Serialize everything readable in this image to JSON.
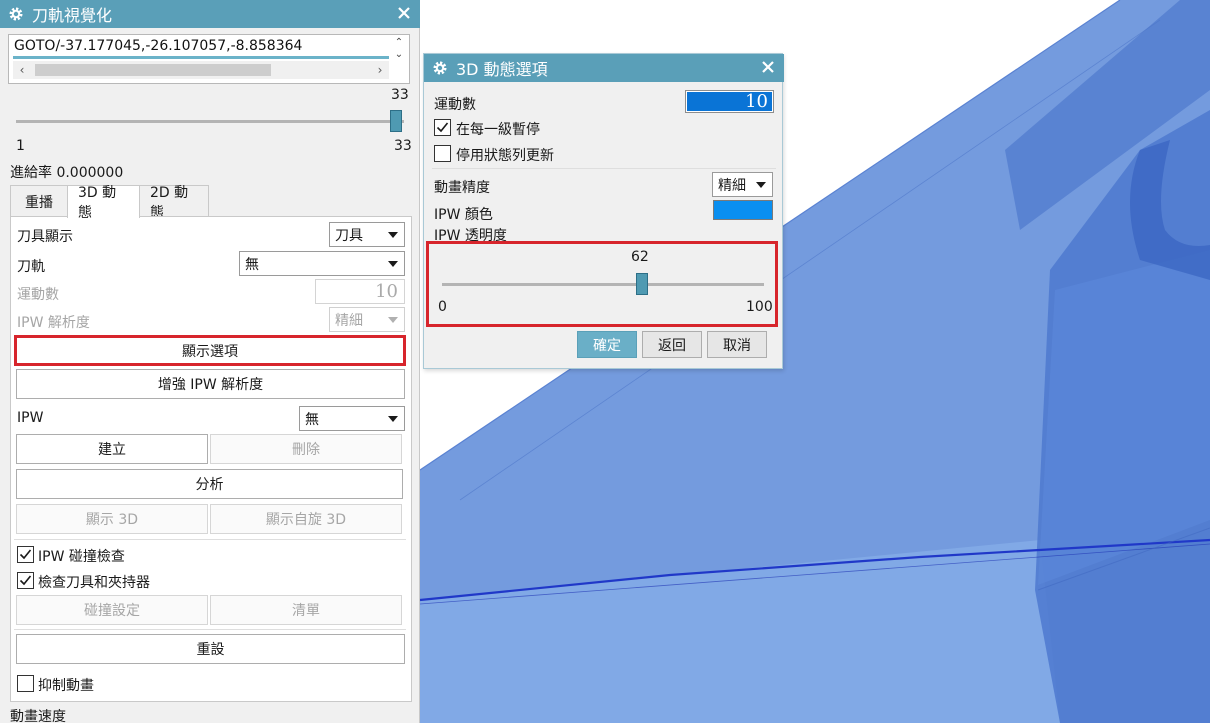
{
  "main_panel": {
    "title": "刀軌視覺化",
    "goto_text": "GOTO/-37.177045,-26.107057,-8.858364",
    "step_slider": {
      "value": 33,
      "min": 1,
      "max": 33,
      "value_label": "33",
      "min_label": "1",
      "max_label": "33"
    },
    "feed_rate_label": "進給率 0.000000",
    "tabs": [
      {
        "label": "重播",
        "active": false
      },
      {
        "label": "3D 動態",
        "active": true
      },
      {
        "label": "2D 動態",
        "active": false
      }
    ],
    "tool_display": {
      "label": "刀具顯示",
      "value": "刀具"
    },
    "toolpath": {
      "label": "刀軌",
      "value": "無"
    },
    "motion_count": {
      "label": "運動數",
      "value": "10"
    },
    "ipw_resolution": {
      "label": "IPW 解析度",
      "value": "精細"
    },
    "display_options_button": "顯示選項",
    "enhance_ipw_button": "增強 IPW 解析度",
    "ipw": {
      "label": "IPW",
      "value": "無"
    },
    "create_button": "建立",
    "delete_button": "刪除",
    "analyze_button": "分析",
    "show_3d_button": "顯示 3D",
    "show_spin_3d_button": "顯示自旋 3D",
    "ipw_collision_check": {
      "label": "IPW 碰撞檢查",
      "checked": true
    },
    "check_tool_holder": {
      "label": "檢查刀具和夾持器",
      "checked": true
    },
    "collision_settings_button": "碰撞設定",
    "list_button": "清單",
    "reset_button": "重設",
    "suppress_animation": {
      "label": "抑制動畫",
      "checked": false
    },
    "animation_speed_label": "動畫速度"
  },
  "options_dialog": {
    "title": "3D 動態選項",
    "motion_count": {
      "label": "運動數",
      "value": "10"
    },
    "pause_each_level": {
      "label": "在每一級暫停",
      "checked": true
    },
    "disable_status_update": {
      "label": "停用狀態列更新",
      "checked": false
    },
    "animation_precision": {
      "label": "動畫精度",
      "value": "精細"
    },
    "ipw_color": {
      "label": "IPW 顏色",
      "color": "#0a8ff0"
    },
    "ipw_transparency": {
      "label": "IPW 透明度",
      "value": 62,
      "min": 0,
      "max": 100,
      "value_label": "62",
      "min_label": "0",
      "max_label": "100"
    },
    "ok_button": "確定",
    "back_button": "返回",
    "cancel_button": "取消"
  },
  "colors": {
    "title_bar": "#5a9fb8",
    "highlight_frame": "#d7252c",
    "selection": "#0a74d6",
    "slider_thumb": "#4f9ab2",
    "model_blue": "#6a94dd"
  }
}
